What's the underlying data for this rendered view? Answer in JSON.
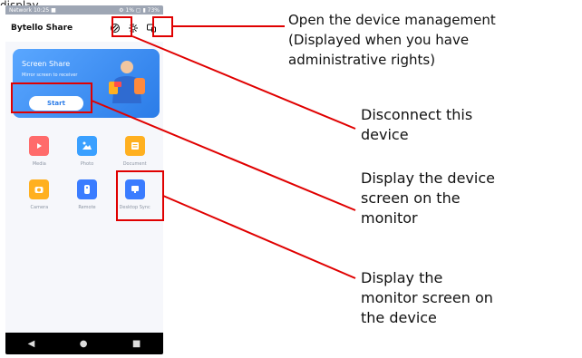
{
  "top_text": "display",
  "phone": {
    "status": {
      "left": "Network 10:25 ■",
      "right": "⚙ 1% ▢ ▮ 73%"
    },
    "app_title": "Bytello Share",
    "card": {
      "title": "Screen Share",
      "subtitle": "Mirror screen to receiver",
      "button_label": "Start"
    },
    "tiles": [
      {
        "label": "Media",
        "icon": "media-icon",
        "color": "#ff6b6b"
      },
      {
        "label": "Photo",
        "icon": "photo-icon",
        "color": "#3aa0ff"
      },
      {
        "label": "Document",
        "icon": "document-icon",
        "color": "#ffb020"
      },
      {
        "label": "Camera",
        "icon": "camera-icon",
        "color": "#ffb020"
      },
      {
        "label": "Remote",
        "icon": "remote-icon",
        "color": "#3a7cff"
      },
      {
        "label": "Desktop Sync",
        "icon": "desktop-sync-icon",
        "color": "#3a7cff"
      }
    ],
    "nav": [
      "◀",
      "●",
      "■"
    ]
  },
  "annotations": {
    "device_management": "Open the device management\n(Displayed when you have\nadministrative rights)",
    "disconnect": "Disconnect this\ndevice",
    "display_device": "Display the device\nscreen on the\nmonitor",
    "display_monitor": "Display the\nmonitor screen on\nthe device"
  },
  "colors": {
    "highlight": "#e00000",
    "card_accent": "#2b7ce8"
  }
}
